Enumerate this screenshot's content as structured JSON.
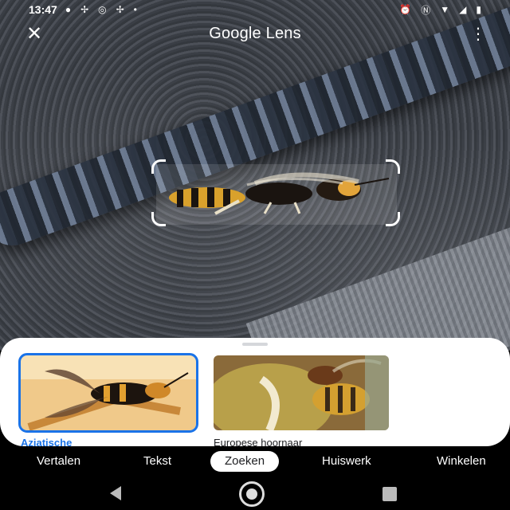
{
  "status_bar": {
    "time": "13:47",
    "left_icons": [
      "messenger-icon",
      "fan-icon",
      "instagram-icon",
      "fan-icon",
      "dot-icon"
    ],
    "right_icons": [
      "alarm-icon",
      "nfc-icon",
      "wifi-icon",
      "signal-icon",
      "battery-icon"
    ]
  },
  "top_bar": {
    "title": "Google Lens",
    "close_glyph": "✕",
    "more_glyph": "⋮"
  },
  "results": [
    {
      "label": "Aziatische",
      "selected": true
    },
    {
      "label": "Europese hoornaar",
      "selected": false
    }
  ],
  "mode_tabs": [
    {
      "label": "Vertalen",
      "active": false
    },
    {
      "label": "Tekst",
      "active": false
    },
    {
      "label": "Zoeken",
      "active": true
    },
    {
      "label": "Huiswerk",
      "active": false
    },
    {
      "label": "Winkelen",
      "active": false
    }
  ],
  "colors": {
    "accent": "#1a73e8",
    "sheet_bg": "#ffffff",
    "screen_bg": "#000000"
  }
}
